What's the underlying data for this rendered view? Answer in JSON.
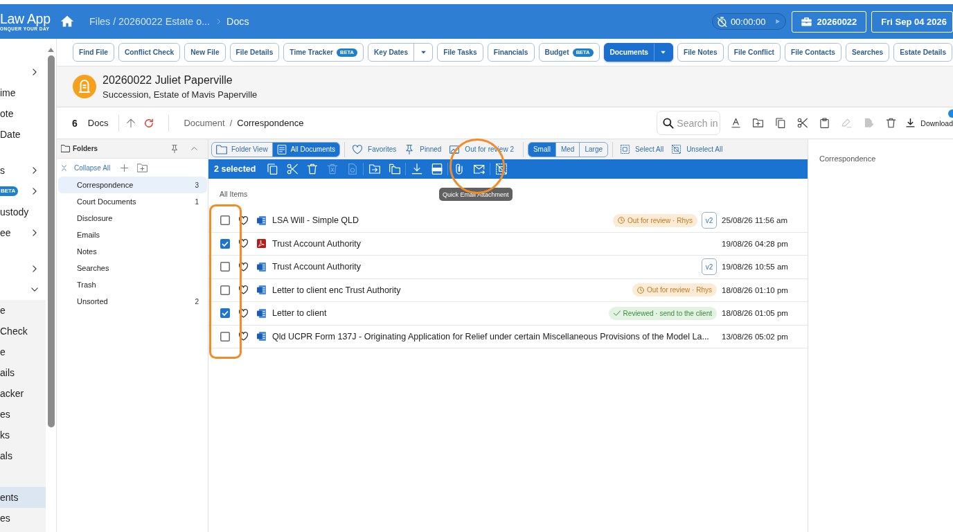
{
  "header": {
    "logo": {
      "name": "Law App",
      "tagline": "ONQUER YOUR DAY"
    },
    "breadcrumb": [
      "Files / 20260022 Estate o...",
      "Docs"
    ],
    "timer": "00:00:00",
    "file_button": "20260022",
    "date_button": "Fri Sep 04 2026"
  },
  "sidebar": {
    "sections": [
      {
        "items": [
          {
            "kind": "group",
            "expanded": false,
            "selected": false
          },
          {
            "kind": "link",
            "label": "ime",
            "selected": false
          },
          {
            "kind": "link",
            "label": "ote",
            "selected": false
          },
          {
            "kind": "link",
            "label": "Date",
            "selected": false
          }
        ]
      },
      {
        "items": [
          {
            "kind": "group",
            "label": "s",
            "expanded": false,
            "selected": false
          },
          {
            "kind": "group",
            "badge": "BETA",
            "expanded": false,
            "selected": false
          },
          {
            "kind": "link",
            "label": "ustody",
            "selected": false
          },
          {
            "kind": "group",
            "label": "ee",
            "expanded": false,
            "selected": false
          }
        ]
      },
      {
        "items": [
          {
            "kind": "group",
            "expanded": false,
            "selected": false
          },
          {
            "kind": "group",
            "expanded": true,
            "selected": false,
            "children": [
              {
                "label": "e",
                "selected": false
              },
              {
                "label": "Check",
                "selected": false
              },
              {
                "label": "e",
                "selected": false
              },
              {
                "label": "ails",
                "selected": false
              },
              {
                "label": "acker",
                "selected": false
              },
              {
                "label": "es",
                "selected": false
              },
              {
                "label": "ks",
                "selected": false
              },
              {
                "label": "als",
                "selected": false
              },
              {
                "selected": false
              },
              {
                "label": "ents",
                "selected": true
              },
              {
                "label": "es",
                "selected": false
              }
            ]
          }
        ]
      }
    ]
  },
  "tabs": [
    {
      "label": "Find File",
      "selected": false
    },
    {
      "label": "Conflict Check",
      "selected": false
    },
    {
      "label": "New File",
      "selected": false
    },
    {
      "label": "File Details",
      "selected": false
    },
    {
      "label": "Time Tracker",
      "badge": "BETA",
      "selected": false
    },
    {
      "label": "Key Dates",
      "dropdown": true,
      "selected": false
    },
    {
      "label": "File Tasks",
      "selected": false
    },
    {
      "label": "Financials",
      "selected": false
    },
    {
      "label": "Budget",
      "badge": "BETA",
      "selected": false
    },
    {
      "label": "Documents",
      "dropdown": true,
      "selected": true
    },
    {
      "label": "File Notes",
      "selected": false
    },
    {
      "label": "File Conflict",
      "selected": false
    },
    {
      "label": "File Contacts",
      "selected": false
    },
    {
      "label": "Searches",
      "selected": false
    },
    {
      "label": "Estate Details",
      "selected": false
    }
  ],
  "file_header": {
    "title": "20260022 Juliet Paperville",
    "subtitle": "Succession, Estate of Mavis Paperville"
  },
  "toolbar": {
    "count": "6",
    "count_label": "Docs",
    "path": [
      "Document",
      "Correspondence"
    ],
    "path_separator": "/",
    "search": {
      "placeholder": "Search in"
    },
    "actions": [
      {
        "kind": "rename",
        "disabled": false
      },
      {
        "kind": "new-folder",
        "disabled": false
      },
      {
        "kind": "copy",
        "disabled": false
      },
      {
        "kind": "cut",
        "disabled": false
      },
      {
        "kind": "paste",
        "disabled": false
      },
      {
        "kind": "edit",
        "disabled": true
      },
      {
        "kind": "sign",
        "disabled": true
      },
      {
        "kind": "delete",
        "disabled": false
      }
    ],
    "download_label": "Download"
  },
  "folders": {
    "title": "Folders",
    "collapse_label": "Collapse All",
    "items": [
      {
        "name": "Correspondence",
        "count": "3",
        "selected": true
      },
      {
        "name": "Court Documents",
        "count": "1",
        "selected": false
      },
      {
        "name": "Disclosure",
        "selected": false
      },
      {
        "name": "Emails",
        "selected": false
      },
      {
        "name": "Notes",
        "selected": false
      },
      {
        "name": "Searches",
        "selected": false
      },
      {
        "name": "Trash",
        "selected": false
      },
      {
        "name": "Unsorted",
        "count": "2",
        "selected": false
      }
    ]
  },
  "filter_bar": {
    "views": [
      {
        "kind": "folder",
        "label": "Folder View",
        "selected": false
      },
      {
        "kind": "all",
        "label": "All Documents",
        "selected": true
      }
    ],
    "filters": [
      {
        "kind": "favorites",
        "label": "Favorites"
      },
      {
        "kind": "pinned",
        "label": "Pinned"
      },
      {
        "kind": "review",
        "label": "Out for review 2"
      }
    ],
    "sizes": [
      {
        "label": "Small",
        "selected": true
      },
      {
        "label": "Med",
        "selected": false
      },
      {
        "label": "Large",
        "selected": false
      }
    ],
    "selection": [
      {
        "kind": "select",
        "label": "Select All"
      },
      {
        "kind": "unselect",
        "label": "Unselect All"
      }
    ]
  },
  "selection_bar": {
    "label": "2 selected",
    "groups": [
      {
        "actions": [
          {
            "kind": "copy",
            "disabled": false
          },
          {
            "kind": "cut",
            "disabled": false
          },
          {
            "kind": "delete",
            "disabled": false
          },
          {
            "kind": "delete-forever",
            "disabled": true
          },
          {
            "kind": "restore",
            "disabled": true
          }
        ]
      },
      {
        "actions": [
          {
            "kind": "move",
            "disabled": false
          },
          {
            "kind": "copy-to",
            "disabled": false
          }
        ]
      },
      {
        "actions": [
          {
            "kind": "download",
            "disabled": false
          },
          {
            "kind": "pdf",
            "disabled": false
          }
        ]
      },
      {
        "actions": [
          {
            "kind": "attach",
            "disabled": false
          },
          {
            "kind": "email",
            "disabled": false
          }
        ]
      },
      {
        "actions": [
          {
            "kind": "unselect",
            "disabled": false
          }
        ]
      }
    ]
  },
  "tooltip": {
    "label": "Quick Email Attachment"
  },
  "list": {
    "group_label": "All Items",
    "rows": [
      {
        "name": "LSA Will - Simple QLD",
        "kind": "word",
        "checked": false,
        "favorite": false,
        "status": {
          "kind": "review",
          "label": "Out for review · Rhys"
        },
        "version": "v2",
        "date": "25/08/26 11:56 am"
      },
      {
        "name": "Trust Account Authority",
        "kind": "pdf",
        "checked": true,
        "favorite": false,
        "date": "19/08/26 04:28 pm"
      },
      {
        "name": "Trust Account Authority",
        "kind": "word",
        "checked": false,
        "favorite": false,
        "version": "v2",
        "date": "19/08/26 10:55 am"
      },
      {
        "name": "Letter to client enc Trust Authority",
        "kind": "word",
        "checked": false,
        "favorite": false,
        "status": {
          "kind": "review",
          "label": "Out for review · Rhys"
        },
        "date": "18/08/26 01:10 pm"
      },
      {
        "name": "Letter to client",
        "kind": "word",
        "checked": true,
        "favorite": false,
        "status": {
          "kind": "reviewed",
          "label": "Reviewed · send to the client"
        },
        "date": "18/08/26 01:05 pm"
      },
      {
        "name": "Qld UCPR Form 137J - Originating Application for Relief under certain Miscellaneous Provisions of the Model La...",
        "kind": "word",
        "checked": false,
        "favorite": false,
        "date": "13/08/26 05:02 pm"
      }
    ]
  },
  "preview": {
    "title": "Correspondence"
  },
  "annotations": [
    {
      "kind": "circle"
    },
    {
      "kind": "rectangle"
    }
  ]
}
